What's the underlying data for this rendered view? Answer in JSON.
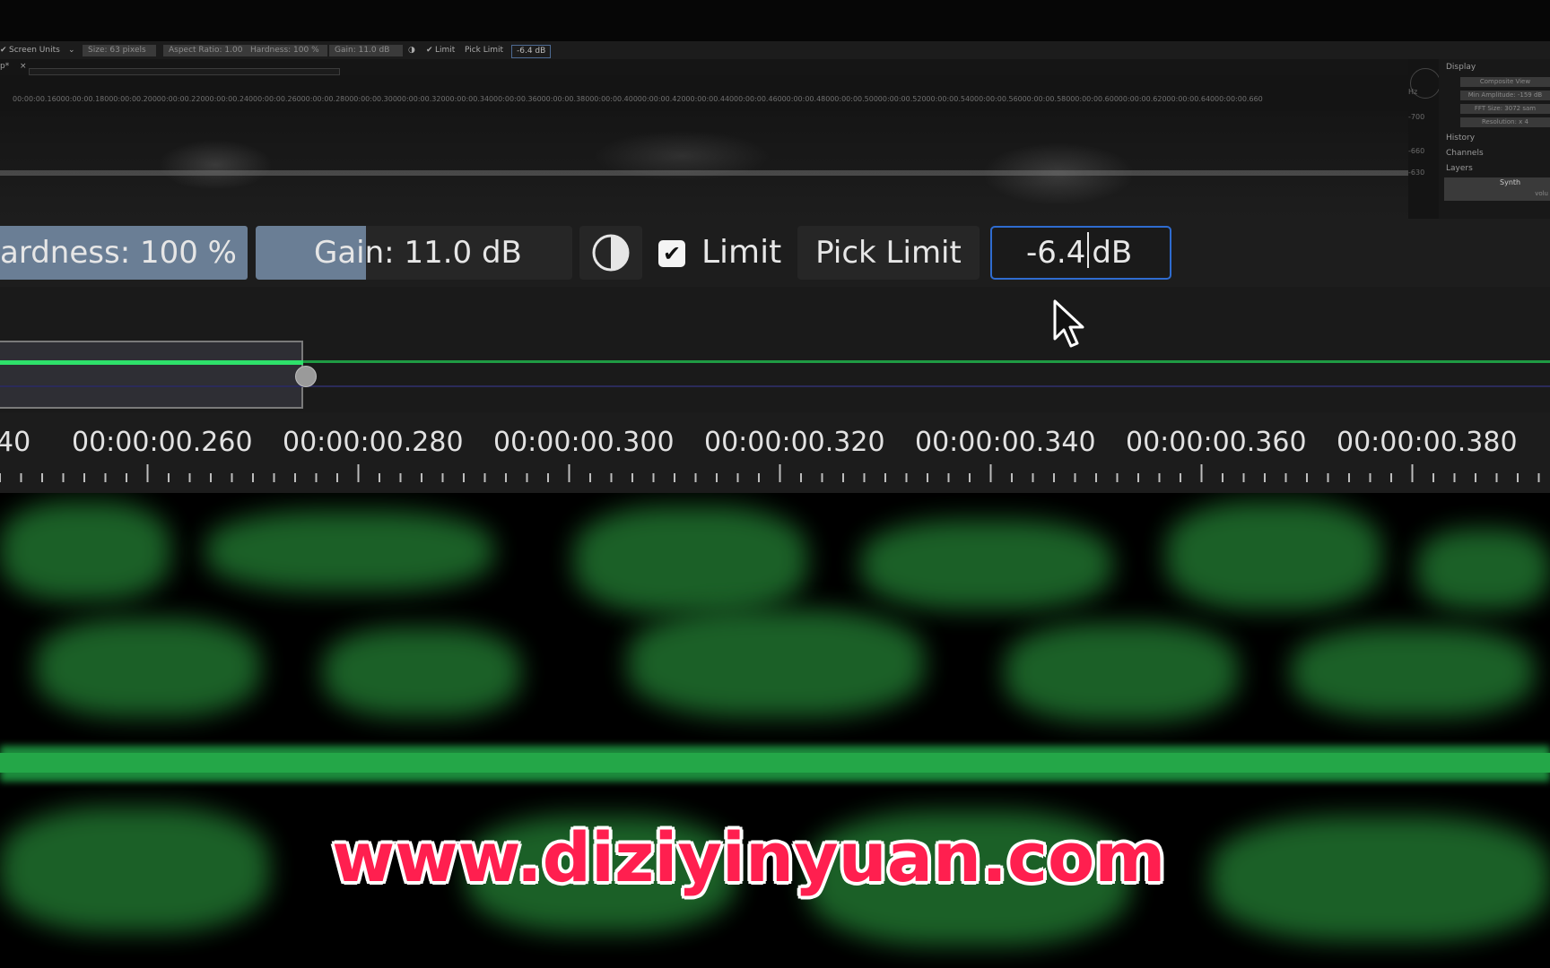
{
  "mini": {
    "toolbar": {
      "screen_units": "Screen Units",
      "size": "Size: 63 pixels",
      "aspect_ratio": "Aspect Ratio: 1.00",
      "hardness": "Hardness: 100 %",
      "gain": "Gain: 11.0 dB",
      "limit_label": "Limit",
      "pick_limit": "Pick Limit",
      "limit_value": "-6.4 dB"
    },
    "tab_label": "p*",
    "ruler_labels": [
      "00:00:00.160",
      "00:00:00.180",
      "00:00:00.200",
      "00:00:00.220",
      "00:00:00.240",
      "00:00:00.260",
      "00:00:00.280",
      "00:00:00.300",
      "00:00:00.320",
      "00:00:00.340",
      "00:00:00.360",
      "00:00:00.380",
      "00:00:00.400",
      "00:00:00.420",
      "00:00:00.440",
      "00:00:00.460",
      "00:00:00.480",
      "00:00:00.500",
      "00:00:00.520",
      "00:00:00.540",
      "00:00:00.560",
      "00:00:00.580",
      "00:00:00.600",
      "00:00:00.620",
      "00:00:00.640",
      "00:00:00.660"
    ],
    "freq_labels": [
      "Hz",
      "-700",
      "-660",
      "-630"
    ],
    "panel": {
      "display": "Display",
      "composite_view": "Composite View",
      "min_amplitude": "Min Amplitude: -159 dB",
      "fft_size": "FFT Size: 3072 sam",
      "resolution": "Resolution: x 4",
      "history": "History",
      "channels": "Channels",
      "layers": "Layers",
      "synth": "Synth",
      "volume": "volu"
    }
  },
  "toolbar": {
    "hardness": "ardness: 100 %",
    "gain": "Gain: 11.0 dB",
    "gain_fill_fraction": 0.35,
    "invert_icon": "half-circle-icon",
    "limit_checked": true,
    "limit_label": "Limit",
    "pick_limit": "Pick Limit",
    "limit_value": "-6.4",
    "limit_unit": "dB"
  },
  "timeline": {
    "labels": [
      "40",
      "00:00:00.260",
      "00:00:00.280",
      "00:00:00.300",
      "00:00:00.320",
      "00:00:00.340",
      "00:00:00.360",
      "00:00:00.380"
    ]
  },
  "watermark": "www.diziyinyuan.com",
  "colors": {
    "accent_blue": "#2f6cd0",
    "automation_green": "#2ee06a",
    "spectrogram_green": "#1e6b2c",
    "watermark_red": "#ff1f4f"
  }
}
